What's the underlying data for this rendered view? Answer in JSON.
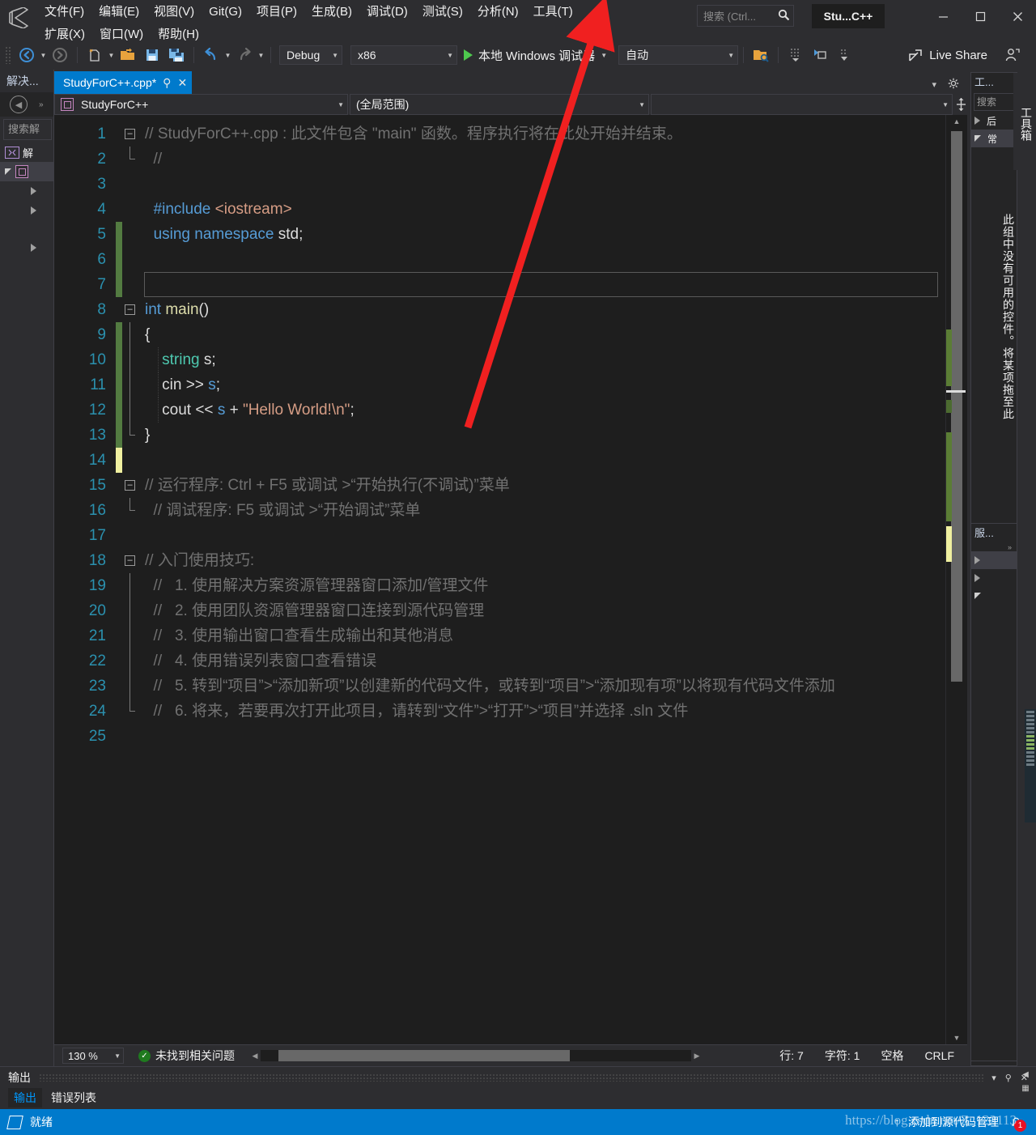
{
  "window": {
    "title_badge": "Stu...C++",
    "minimize": "–",
    "maximize": "□",
    "close": "✕"
  },
  "menubar": {
    "items": [
      {
        "label": "文件(F)",
        "name": "menu-file"
      },
      {
        "label": "编辑(E)",
        "name": "menu-edit"
      },
      {
        "label": "视图(V)",
        "name": "menu-view"
      },
      {
        "label": "Git(G)",
        "name": "menu-git"
      },
      {
        "label": "项目(P)",
        "name": "menu-project"
      },
      {
        "label": "生成(B)",
        "name": "menu-build"
      },
      {
        "label": "调试(D)",
        "name": "menu-debug"
      },
      {
        "label": "测试(S)",
        "name": "menu-test"
      },
      {
        "label": "分析(N)",
        "name": "menu-analyze"
      },
      {
        "label": "工具(T)",
        "name": "menu-tools"
      },
      {
        "label": "扩展(X)",
        "name": "menu-extensions"
      },
      {
        "label": "窗口(W)",
        "name": "menu-window"
      },
      {
        "label": "帮助(H)",
        "name": "menu-help"
      }
    ]
  },
  "search": {
    "placeholder": "搜索 (Ctrl...",
    "icon": "search-icon"
  },
  "toolbar": {
    "configuration": "Debug",
    "platform": "x86",
    "run_label": "本地 Windows 调试器",
    "auto_label": "自动",
    "live_share": "Live Share"
  },
  "solution_explorer": {
    "title": "解决...",
    "search_placeholder": "搜索解",
    "nodes": [
      {
        "label": "解",
        "name": "solution-node"
      },
      {
        "label": "",
        "name": "project-node"
      },
      {
        "label": "",
        "name": "folder-node-1"
      },
      {
        "label": "",
        "name": "folder-node-2"
      },
      {
        "label": "",
        "name": "folder-node-3"
      }
    ]
  },
  "editor": {
    "tab_title": "StudyForC++.cpp*",
    "pin_icon": "pin-icon",
    "close_icon": "close-icon",
    "nav_project": "StudyForC++",
    "nav_scope": "(全局范围)",
    "nav_member": "",
    "code_lines": [
      {
        "n": "1",
        "fold": "minus",
        "tokens": [
          {
            "t": "// StudyForC++.cpp : 此文件包含 \"main\" 函数。程序执行将在此处开始并结束。",
            "c": "cmt-doc"
          }
        ]
      },
      {
        "n": "2",
        "fold": "end",
        "tokens": [
          {
            "t": "  //",
            "c": "cmt-doc"
          }
        ]
      },
      {
        "n": "3",
        "fold": "",
        "tokens": []
      },
      {
        "n": "4",
        "fold": "",
        "tokens": [
          {
            "t": "  ",
            "c": "pln"
          },
          {
            "t": "#include ",
            "c": "kw"
          },
          {
            "t": "<iostream>",
            "c": "str"
          }
        ]
      },
      {
        "n": "5",
        "fold": "",
        "tokens": [
          {
            "t": "  ",
            "c": "pln"
          },
          {
            "t": "using namespace ",
            "c": "kw"
          },
          {
            "t": "std;",
            "c": "pln"
          }
        ]
      },
      {
        "n": "6",
        "fold": "",
        "tokens": []
      },
      {
        "n": "7",
        "fold": "",
        "tokens": [],
        "current": true
      },
      {
        "n": "8",
        "fold": "minus",
        "tokens": [
          {
            "t": "int ",
            "c": "kw"
          },
          {
            "t": "main",
            "c": "typ"
          },
          {
            "t": "()",
            "c": "pln"
          }
        ]
      },
      {
        "n": "9",
        "fold": "bar",
        "tokens": [
          {
            "t": "{",
            "c": "pln"
          }
        ]
      },
      {
        "n": "10",
        "fold": "bar",
        "tokens": [
          {
            "t": "    ",
            "c": "pln"
          },
          {
            "t": "string",
            "c": "kw2"
          },
          {
            "t": " s;",
            "c": "pln"
          }
        ]
      },
      {
        "n": "11",
        "fold": "bar",
        "tokens": [
          {
            "t": "    ",
            "c": "pln"
          },
          {
            "t": "cin ",
            "c": "pln"
          },
          {
            "t": ">> ",
            "c": "op"
          },
          {
            "t": "s",
            "c": "kw"
          },
          {
            "t": ";",
            "c": "pln"
          }
        ]
      },
      {
        "n": "12",
        "fold": "bar",
        "tokens": [
          {
            "t": "    ",
            "c": "pln"
          },
          {
            "t": "cout ",
            "c": "pln"
          },
          {
            "t": "<< ",
            "c": "op"
          },
          {
            "t": "s",
            "c": "kw"
          },
          {
            "t": " + ",
            "c": "op"
          },
          {
            "t": "\"Hello World!\\n\"",
            "c": "str"
          },
          {
            "t": ";",
            "c": "pln"
          }
        ]
      },
      {
        "n": "13",
        "fold": "end",
        "tokens": [
          {
            "t": "}",
            "c": "pln"
          }
        ]
      },
      {
        "n": "14",
        "fold": "",
        "tokens": []
      },
      {
        "n": "15",
        "fold": "minus",
        "tokens": [
          {
            "t": "// 运行程序: Ctrl + F5 或调试 >“开始执行(不调试)”菜单",
            "c": "cmt-doc"
          }
        ]
      },
      {
        "n": "16",
        "fold": "end",
        "tokens": [
          {
            "t": "  // 调试程序: F5 或调试 >“开始调试”菜单",
            "c": "cmt-doc"
          }
        ]
      },
      {
        "n": "17",
        "fold": "",
        "tokens": []
      },
      {
        "n": "18",
        "fold": "minus",
        "tokens": [
          {
            "t": "// 入门使用技巧:",
            "c": "cmt-doc"
          }
        ]
      },
      {
        "n": "19",
        "fold": "bar",
        "tokens": [
          {
            "t": "  //   1. 使用解决方案资源管理器窗口添加/管理文件",
            "c": "cmt-doc"
          }
        ]
      },
      {
        "n": "20",
        "fold": "bar",
        "tokens": [
          {
            "t": "  //   2. 使用团队资源管理器窗口连接到源代码管理",
            "c": "cmt-doc"
          }
        ]
      },
      {
        "n": "21",
        "fold": "bar",
        "tokens": [
          {
            "t": "  //   3. 使用输出窗口查看生成输出和其他消息",
            "c": "cmt-doc"
          }
        ]
      },
      {
        "n": "22",
        "fold": "bar",
        "tokens": [
          {
            "t": "  //   4. 使用错误列表窗口查看错误",
            "c": "cmt-doc"
          }
        ]
      },
      {
        "n": "23",
        "fold": "bar",
        "tokens": [
          {
            "t": "  //   5. 转到“项目”>“添加新项”以创建新的代码文件，或转到“项目”>“添加现有项”以将现有代码文件添加",
            "c": "cmt-doc"
          }
        ]
      },
      {
        "n": "24",
        "fold": "end",
        "tokens": [
          {
            "t": "  //   6. 将来，若要再次打开此项目，请转到“文件”>“打开”>“项目”并选择 .sln 文件",
            "c": "cmt-doc"
          }
        ]
      },
      {
        "n": "25",
        "fold": "",
        "tokens": []
      }
    ]
  },
  "editor_status": {
    "zoom": "130 %",
    "issues": "未找到相关问题",
    "line_label": "行: 7",
    "char_label": "字符: 1",
    "indent": "空格",
    "eol": "CRLF"
  },
  "toolbox": {
    "title": "工...",
    "search_placeholder": "搜索",
    "nodes": [
      {
        "label": "后",
        "name": "toolbox-group-general-collapsed"
      },
      {
        "label": "常",
        "name": "toolbox-group-common"
      }
    ],
    "empty_message": "此组中没有可用的控件。将某项拖至此",
    "vertical_tab": "工具箱",
    "server_explorer_title": "服..."
  },
  "output": {
    "panel_title": "输出",
    "tabs": [
      {
        "label": "输出",
        "active": true,
        "name": "tab-output"
      },
      {
        "label": "错误列表",
        "active": false,
        "name": "tab-error-list"
      }
    ],
    "pin_icon": "pin-icon",
    "close_icon": "close-icon",
    "chevron_icon": "chevron-down-icon"
  },
  "statusbar": {
    "state": "就绪",
    "source_control": "添加到源代码管理",
    "notification_count": "1",
    "watermark": "https://blog.csdn.net/Z_122113"
  },
  "colors": {
    "accent": "#007acc",
    "titlebar_bg": "#2d2d30",
    "editor_bg": "#1e1e1e",
    "linenum": "#2b91af",
    "comment": "#717171",
    "keyword": "#569cd6",
    "string": "#d69d85",
    "type": "#4ec9b0",
    "function": "#dcdcaa",
    "change_green": "#537b41",
    "change_yellow": "#f0f0a0",
    "annotation_arrow": "#f02020"
  }
}
